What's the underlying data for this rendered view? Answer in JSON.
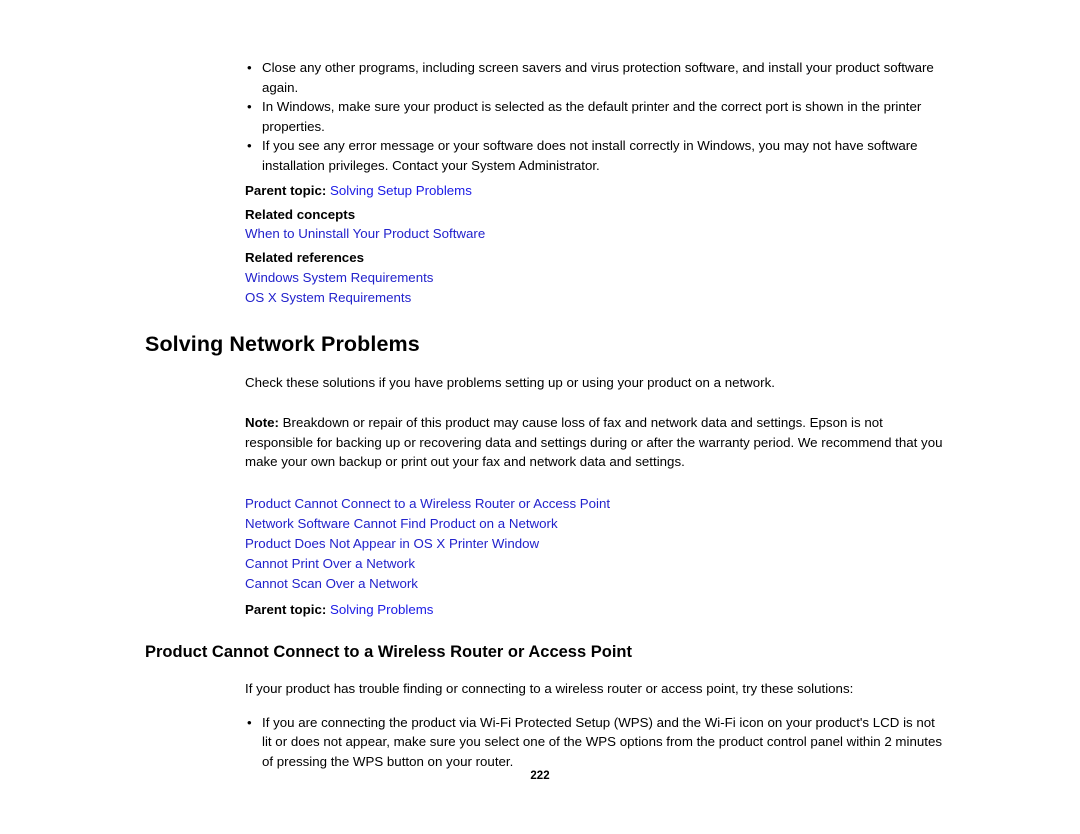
{
  "top_bullets": [
    "Close any other programs, including screen savers and virus protection software, and install your product software again.",
    "In Windows, make sure your product is selected as the default printer and the correct port is shown in the printer properties.",
    "If you see any error message or your software does not install correctly in Windows, you may not have software installation privileges. Contact your System Administrator."
  ],
  "bullet_char": "•",
  "parent_topic_1": {
    "label": "Parent topic:",
    "link": "Solving Setup Problems"
  },
  "related_concepts": {
    "heading": "Related concepts",
    "links": [
      "When to Uninstall Your Product Software"
    ]
  },
  "related_references": {
    "heading": "Related references",
    "links": [
      "Windows System Requirements",
      "OS X System Requirements"
    ]
  },
  "section": {
    "title": "Solving Network Problems",
    "intro": "Check these solutions if you have problems setting up or using your product on a network.",
    "note_label": "Note:",
    "note_text": " Breakdown or repair of this product may cause loss of fax and network data and settings. Epson is not responsible for backing up or recovering data and settings during or after the warranty period. We recommend that you make your own backup or print out your fax and network data and settings.",
    "toc": [
      "Product Cannot Connect to a Wireless Router or Access Point",
      "Network Software Cannot Find Product on a Network",
      "Product Does Not Appear in OS X Printer Window",
      "Cannot Print Over a Network",
      "Cannot Scan Over a Network"
    ],
    "parent_topic": {
      "label": "Parent topic:",
      "link": "Solving Problems"
    }
  },
  "subsection": {
    "title": "Product Cannot Connect to a Wireless Router or Access Point",
    "intro": "If your product has trouble finding or connecting to a wireless router or access point, try these solutions:",
    "bullets": [
      "If you are connecting the product via Wi-Fi Protected Setup (WPS) and the Wi-Fi icon on your product's LCD is not lit or does not appear, make sure you select one of the WPS options from the product control panel within 2 minutes of pressing the WPS button on your router."
    ]
  },
  "page_number": "222"
}
